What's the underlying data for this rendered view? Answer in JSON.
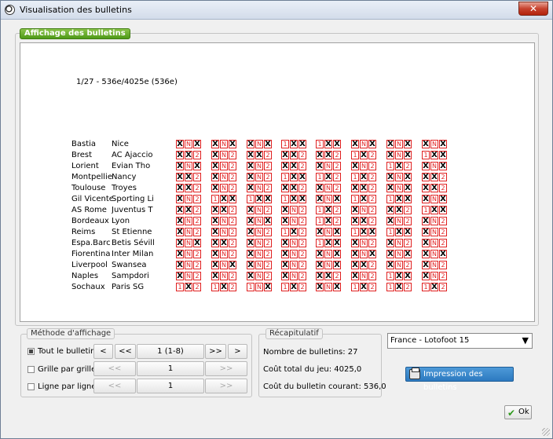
{
  "window": {
    "title": "Visualisation des bulletins",
    "close": "✕"
  },
  "main": {
    "tab_label": "Affichage des bulletins",
    "bulletin_header": "1/27 - 536e/4025e (536e)",
    "selected_color": "#000000",
    "cell_color": "#e02020",
    "matches": [
      {
        "home": "Bastia",
        "away": "Nice",
        "picks": [
          "X1",
          "N",
          "X2",
          "12",
          "1N",
          "X",
          "X",
          "X",
          "1N",
          "X",
          "X",
          "X",
          "X",
          "1",
          "X",
          "X"
        ]
      },
      {
        "home": "Brest",
        "away": "AC Ajaccio",
        "picks": [
          "X1",
          "X",
          "X",
          "X",
          "X1",
          "X",
          "X",
          "X",
          "X1",
          "X",
          "X",
          "X",
          "X",
          "X",
          "X",
          "X"
        ]
      },
      {
        "home": "Lorient",
        "away": "Evian Tho",
        "picks": [
          "X1",
          "X",
          "X",
          "X",
          "X1",
          "X",
          "X",
          "X",
          "X1",
          "X",
          "X",
          "X",
          "X",
          "X",
          "X",
          "X"
        ]
      },
      {
        "home": "Montpellier",
        "away": "Nancy",
        "picks": [
          "X1",
          "X",
          "X",
          "X",
          "X1",
          "X",
          "X",
          "X",
          "X1",
          "X",
          "X",
          "X",
          "X",
          "X",
          "X",
          "X"
        ]
      },
      {
        "home": "Toulouse",
        "away": "Troyes",
        "picks": [
          "X1",
          "X",
          "X",
          "X",
          "X1",
          "X",
          "X",
          "X",
          "X1",
          "X",
          "X",
          "X",
          "X",
          "X",
          "X",
          "X"
        ]
      },
      {
        "home": "Gil Vicente",
        "away": "Sporting Li",
        "picks": [
          "1X",
          "X",
          "X",
          "X",
          "1X",
          "X",
          "X",
          "X",
          "1X",
          "X",
          "X",
          "X",
          "X",
          "X",
          "X",
          "X"
        ]
      },
      {
        "home": "AS Rome",
        "away": "Juventus T",
        "picks": [
          "X1",
          "X",
          "X",
          "X",
          "X1",
          "X",
          "X",
          "X",
          "X1",
          "X",
          "X",
          "X",
          "X",
          "X",
          "X",
          "X"
        ]
      },
      {
        "home": "Bordeaux",
        "away": "Lyon",
        "picks": [
          "X1",
          "X",
          "X",
          "X",
          "X1",
          "X",
          "X",
          "X",
          "X1",
          "X",
          "X",
          "X",
          "X",
          "X",
          "X",
          "X"
        ]
      },
      {
        "home": "Reims",
        "away": "St Etienne",
        "picks": [
          "X1",
          "X",
          "X",
          "X",
          "X1",
          "X",
          "X",
          "X",
          "X1",
          "X",
          "X",
          "X",
          "X",
          "X",
          "X",
          "X"
        ]
      },
      {
        "home": "Espa.Barc",
        "away": "Betis Sévill",
        "picks": [
          "X1",
          "X",
          "X",
          "X",
          "X1",
          "X",
          "X",
          "X",
          "X1",
          "X",
          "X",
          "X",
          "X",
          "X",
          "X",
          "X"
        ]
      },
      {
        "home": "Fiorentina",
        "away": "Inter Milan",
        "picks": [
          "X1",
          "X",
          "X",
          "X",
          "X1",
          "X",
          "X",
          "X",
          "X1",
          "X",
          "X",
          "X",
          "X",
          "X",
          "X",
          "X"
        ]
      },
      {
        "home": "Liverpool",
        "away": "Swansea",
        "picks": [
          "X1",
          "X",
          "X",
          "X",
          "X1",
          "X",
          "X",
          "X",
          "X1",
          "X",
          "X",
          "X",
          "X",
          "X",
          "X",
          "X"
        ]
      },
      {
        "home": "Naples",
        "away": "Sampdori",
        "picks": [
          "X1",
          "X",
          "X",
          "X",
          "X1",
          "X",
          "X",
          "X",
          "X1",
          "X",
          "X",
          "X",
          "X",
          "X",
          "X",
          "X"
        ]
      },
      {
        "home": "Sochaux",
        "away": "Paris SG",
        "picks": [
          "1X",
          "X",
          "X",
          "X",
          "1X",
          "X",
          "X",
          "X",
          "1X",
          "X",
          "X",
          "X",
          "X",
          "X",
          "X",
          "X"
        ]
      }
    ],
    "grids": [
      [
        "1N2",
        "1N2",
        "1N2",
        "1N2",
        "1N2",
        "1N2",
        "1N2",
        "1N2",
        "1N2",
        "1N2",
        "1N2",
        "1N2",
        "1N2",
        "1N2"
      ]
    ],
    "selections": [
      [
        [
          0,
          2
        ],
        [
          0,
          1
        ],
        [
          0,
          2
        ],
        [
          0,
          1
        ],
        [
          0,
          1
        ],
        [
          0
        ],
        [
          0,
          1
        ],
        [
          0
        ],
        [
          0
        ],
        [
          0,
          2
        ],
        [
          0
        ],
        [
          0
        ],
        [
          0
        ],
        [
          1
        ]
      ],
      [
        [
          0,
          2
        ],
        [
          0
        ],
        [
          0
        ],
        [
          0
        ],
        [
          0
        ],
        [
          1,
          2
        ],
        [
          0,
          1
        ],
        [
          0
        ],
        [
          0
        ],
        [
          0,
          1
        ],
        [
          0
        ],
        [
          0,
          2
        ],
        [
          0
        ],
        [
          1
        ]
      ],
      [
        [
          0,
          2
        ],
        [
          0,
          1
        ],
        [
          0
        ],
        [
          0
        ],
        [
          0
        ],
        [
          1,
          2
        ],
        [
          0
        ],
        [
          0,
          2
        ],
        [
          0
        ],
        [
          0
        ],
        [
          0
        ],
        [
          0
        ],
        [
          0
        ],
        [
          2
        ]
      ],
      [
        [
          1,
          2
        ],
        [
          0,
          1
        ],
        [
          0,
          1
        ],
        [
          1,
          2
        ],
        [
          0,
          1
        ],
        [
          1,
          2
        ],
        [
          0
        ],
        [
          0
        ],
        [
          1
        ],
        [
          0
        ],
        [
          0
        ],
        [
          0
        ],
        [
          0
        ],
        [
          1
        ]
      ],
      [
        [
          1,
          2
        ],
        [
          0,
          1
        ],
        [
          0
        ],
        [
          1
        ],
        [
          0
        ],
        [
          0,
          2
        ],
        [
          1
        ],
        [
          1
        ],
        [
          0,
          2
        ],
        [
          1,
          2
        ],
        [
          0,
          2
        ],
        [
          0,
          2
        ],
        [
          0,
          1
        ],
        [
          0,
          2
        ]
      ],
      [
        [
          0,
          2
        ],
        [
          1
        ],
        [
          0
        ],
        [
          1
        ],
        [
          0,
          1
        ],
        [
          1
        ],
        [
          0
        ],
        [
          0,
          1
        ],
        [
          1,
          2
        ],
        [
          0
        ],
        [
          0,
          2
        ],
        [
          0,
          1
        ],
        [
          0
        ],
        [
          1
        ]
      ],
      [
        [
          0,
          2
        ],
        [
          0,
          2
        ],
        [
          1
        ],
        [
          0,
          2
        ],
        [
          0,
          2
        ],
        [
          1,
          2
        ],
        [
          0,
          1
        ],
        [
          0
        ],
        [
          1,
          2
        ],
        [
          0
        ],
        [
          0,
          2
        ],
        [
          0
        ],
        [
          1,
          2
        ],
        [
          1
        ]
      ],
      [
        [
          0,
          2
        ],
        [
          1,
          2
        ],
        [
          0,
          2
        ],
        [
          0,
          1
        ],
        [
          0,
          1
        ],
        [
          0,
          2
        ],
        [
          1,
          2
        ],
        [
          0
        ],
        [
          0
        ],
        [
          0
        ],
        [
          0,
          2
        ],
        [
          0
        ],
        [
          0
        ],
        [
          1
        ]
      ]
    ]
  },
  "methode": {
    "legend": "Méthode d'affichage",
    "options": [
      {
        "label": "Tout le bulletin",
        "checked": true,
        "page": "1 (1-8)",
        "prev": "<",
        "first": "<<",
        "next": ">>",
        "last": ">"
      },
      {
        "label": "Grille par grille",
        "checked": false,
        "page": "1",
        "prev": "<<",
        "next": ">>"
      },
      {
        "label": "Ligne par ligne",
        "checked": false,
        "page": "1",
        "prev": "<<",
        "next": ">>"
      }
    ]
  },
  "recap": {
    "legend": "Récapitulatif",
    "nombre": "Nombre de bulletins: 27",
    "cout_total": "Coût total du jeu: 4025,0",
    "cout_courant": "Coût du bulletin courant:  536,0"
  },
  "game_select": {
    "value": "France - Lotofoot 15"
  },
  "print_label": "Impression des bulletins",
  "ok_label": "Ok"
}
